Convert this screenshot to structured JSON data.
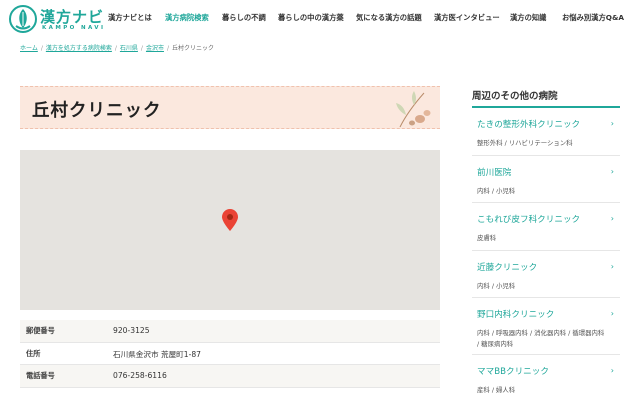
{
  "header": {
    "logo_text": "漢方ナビ",
    "logo_sub": "KAMPO NAVI",
    "nav": [
      {
        "label": "漢方ナビとは",
        "active": false
      },
      {
        "label": "漢方病院検索",
        "active": true
      },
      {
        "label": "暮らしの不調",
        "active": false
      },
      {
        "label": "暮らしの中の漢方薬",
        "active": false
      },
      {
        "label": "気になる漢方の話題",
        "active": false
      },
      {
        "label": "漢方医インタビュー",
        "active": false
      },
      {
        "label": "漢方の知識",
        "active": false
      },
      {
        "label": "お悩み別漢方Q&A",
        "active": false
      }
    ]
  },
  "breadcrumb": {
    "items": [
      "ホーム",
      "漢方を処方する病院検索",
      "石川県",
      "金沢市"
    ],
    "separator": "/",
    "current": "丘村クリニック"
  },
  "clinic": {
    "name": "丘村クリニック"
  },
  "map": {
    "background": "#e5e3df",
    "pin_color": "#ea4335"
  },
  "info": [
    {
      "label": "郵便番号",
      "value": "920-3125"
    },
    {
      "label": "住所",
      "value": "石川県金沢市 荒屋町1-87"
    },
    {
      "label": "電話番号",
      "value": "076-258-6116"
    }
  ],
  "sidebar": {
    "title": "周辺のその他の病院",
    "items": [
      {
        "name": "たきの整形外科クリニック",
        "depts": "整形外科 / リハビリテーション科"
      },
      {
        "name": "前川医院",
        "depts": "内科 / 小児科"
      },
      {
        "name": "こもれび皮フ科クリニック",
        "depts": "皮膚科"
      },
      {
        "name": "近藤クリニック",
        "depts": "内科 / 小児科"
      },
      {
        "name": "野口内科クリニック",
        "depts": "内科 / 呼吸器内科 / 消化器内科 / 循環器内科 / 糖尿病内科"
      },
      {
        "name": "ママBBクリニック",
        "depts": "産科 / 婦人科"
      }
    ],
    "arrow": "›"
  },
  "colors": {
    "accent": "#1fa79a",
    "title_bg": "#fbe8de"
  }
}
